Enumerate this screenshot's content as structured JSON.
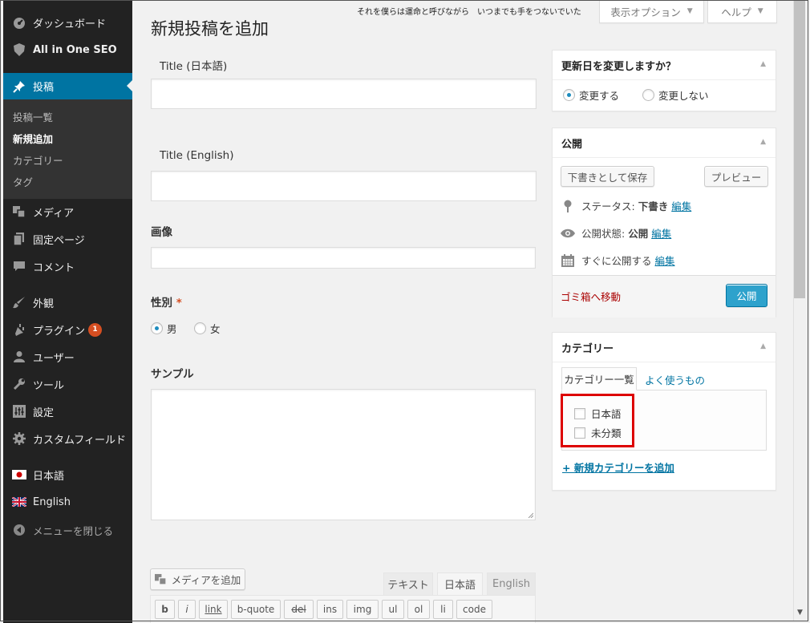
{
  "sidebar": {
    "items": [
      {
        "label": "ダッシュボード",
        "icon": "dashboard-icon"
      },
      {
        "label": "All in One SEO",
        "icon": "shield-icon"
      },
      {
        "label": "投稿",
        "icon": "pin-icon"
      },
      {
        "label": "メディア",
        "icon": "media-icon"
      },
      {
        "label": "固定ページ",
        "icon": "page-icon"
      },
      {
        "label": "コメント",
        "icon": "comment-icon"
      },
      {
        "label": "外観",
        "icon": "brush-icon"
      },
      {
        "label": "プラグイン",
        "icon": "plugin-icon",
        "badge": "1"
      },
      {
        "label": "ユーザー",
        "icon": "user-icon"
      },
      {
        "label": "ツール",
        "icon": "wrench-icon"
      },
      {
        "label": "設定",
        "icon": "settings-icon"
      },
      {
        "label": "カスタムフィールド",
        "icon": "gear-icon"
      },
      {
        "label": "日本語",
        "icon": "japan-flag-icon"
      },
      {
        "label": "English",
        "icon": "uk-flag-icon"
      },
      {
        "label": "メニューを閉じる",
        "icon": "collapse-icon"
      }
    ],
    "submenu": [
      "投稿一覧",
      "新規追加",
      "カテゴリー",
      "タグ"
    ]
  },
  "top": {
    "lyrics": "それを僕らは運命と呼びながら　いつまでも手をつないでいた",
    "screen_options": "表示オプション",
    "help": "ヘルプ"
  },
  "page_title": "新規投稿を追加",
  "form": {
    "title_ja_label": "Title (日本語)",
    "title_en_label": "Title (English)",
    "image_label": "画像",
    "gender_label": "性別",
    "required_mark": "*",
    "gender_options": [
      "男",
      "女"
    ],
    "sample_label": "サンプル"
  },
  "update_box": {
    "title": "更新日を変更しますか？",
    "options": [
      "変更する",
      "変更しない"
    ]
  },
  "publish_box": {
    "title": "公開",
    "save_draft": "下書きとして保存",
    "preview": "プレビュー",
    "status_label": "ステータス:",
    "status_value": "下書き",
    "visibility_label": "公開状態:",
    "visibility_value": "公開",
    "schedule_label": "すぐに公開する",
    "edit": "編集",
    "trash": "ゴミ箱へ移動",
    "publish": "公開"
  },
  "category_box": {
    "title": "カテゴリー",
    "tab_all": "カテゴリー一覧",
    "tab_popular": "よく使うもの",
    "categories": [
      "日本語",
      "未分類"
    ],
    "add_new": "+ 新規カテゴリーを追加"
  },
  "editor": {
    "add_media": "メディアを追加",
    "tabs": [
      "テキスト",
      "日本語",
      "English"
    ],
    "quicktags": [
      "b",
      "i",
      "link",
      "b-quote",
      "del",
      "ins",
      "img",
      "ul",
      "ol",
      "li",
      "code"
    ]
  },
  "colors": {
    "sidebar_bg": "#222222",
    "active_menu": "#0074a2",
    "primary_button": "#2ea2cc",
    "highlight_border": "#dd0000"
  }
}
